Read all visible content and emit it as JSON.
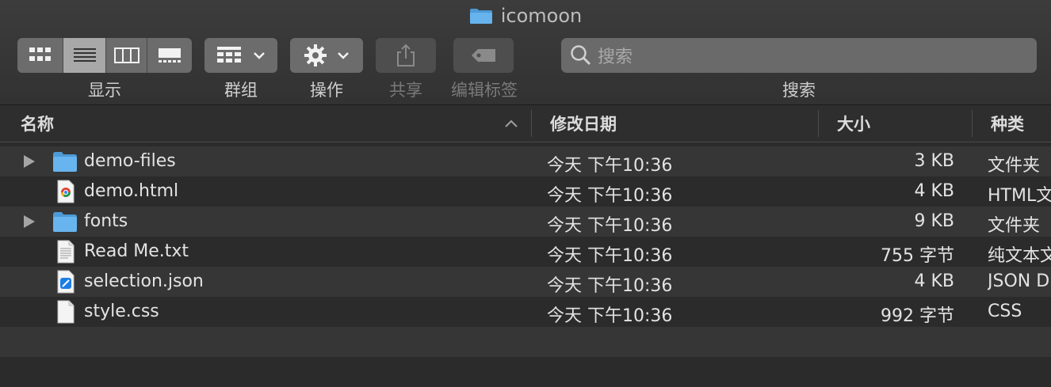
{
  "window": {
    "title": "icomoon"
  },
  "toolbar": {
    "view_label": "显示",
    "group_label": "群组",
    "action_label": "操作",
    "share_label": "共享",
    "tags_label": "编辑标签",
    "search_label": "搜索",
    "search_placeholder": "搜索"
  },
  "columns": {
    "name": "名称",
    "date": "修改日期",
    "size": "大小",
    "kind": "种类"
  },
  "files": [
    {
      "name": "demo-files",
      "date": "今天 下午10:36",
      "size": "3 KB",
      "kind": "文件夹",
      "icon": "folder-icon",
      "expandable": true
    },
    {
      "name": "demo.html",
      "date": "今天 下午10:36",
      "size": "4 KB",
      "kind": "HTML文",
      "icon": "chrome-html-icon",
      "expandable": false
    },
    {
      "name": "fonts",
      "date": "今天 下午10:36",
      "size": "9 KB",
      "kind": "文件夹",
      "icon": "folder-icon",
      "expandable": true
    },
    {
      "name": "Read Me.txt",
      "date": "今天 下午10:36",
      "size": "755 字节",
      "kind": "纯文本文",
      "icon": "text-document-icon",
      "expandable": false
    },
    {
      "name": "selection.json",
      "date": "今天 下午10:36",
      "size": "4 KB",
      "kind": "JSON D",
      "icon": "json-document-icon",
      "expandable": false
    },
    {
      "name": "style.css",
      "date": "今天 下午10:36",
      "size": "992 字节",
      "kind": "CSS",
      "icon": "blank-document-icon",
      "expandable": false
    }
  ],
  "colors": {
    "folder": "#5aa9e6",
    "background": "#2b2b2b",
    "row_alt": "#363636"
  }
}
